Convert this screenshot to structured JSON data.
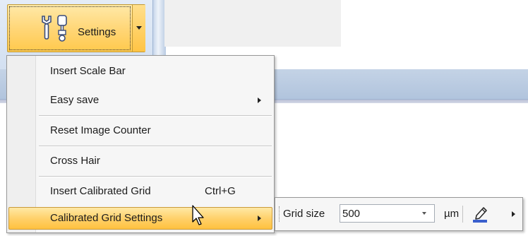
{
  "toolbar": {
    "settings_label": "Settings",
    "settings_icon": "wrench-screwdriver-icon"
  },
  "menu": {
    "items": [
      {
        "label": "Insert Scale Bar"
      },
      {
        "label": "Easy save",
        "has_submenu": true
      },
      {
        "label": "Reset Image Counter"
      },
      {
        "label": "Cross Hair"
      },
      {
        "label": "Insert Calibrated Grid",
        "shortcut": "Ctrl+G"
      },
      {
        "label": "Calibrated Grid Settings",
        "has_submenu": true,
        "highlighted": true
      }
    ]
  },
  "grid_settings": {
    "grid_size_label": "Grid size",
    "grid_size_value": "500",
    "unit": "µm",
    "color_icon": "pen-icon"
  },
  "colors": {
    "highlight": "#ffd16b",
    "pen_underline": "#3a5fcd"
  }
}
